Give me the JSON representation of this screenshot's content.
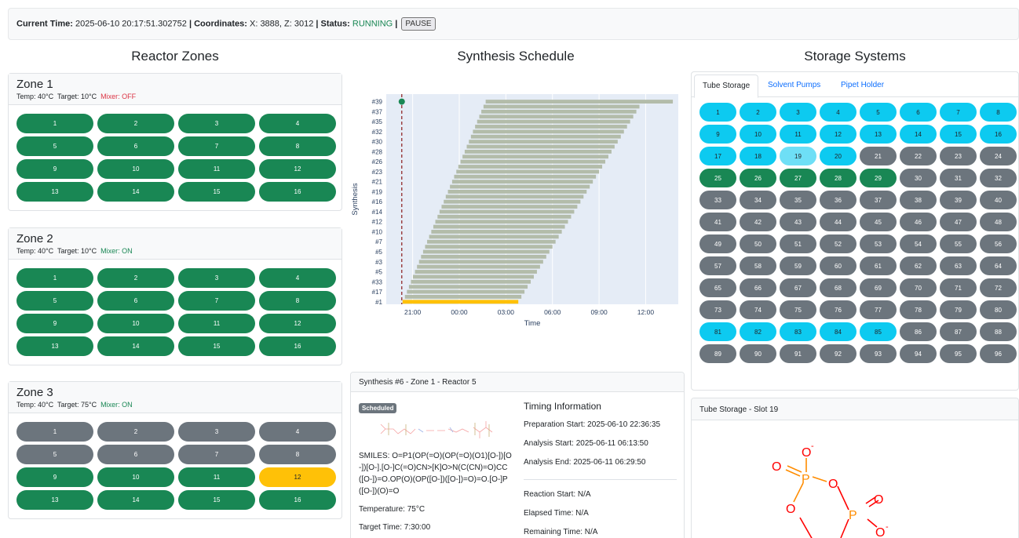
{
  "status": {
    "time_label": "Current Time:",
    "time_value": " 2025-06-10 20:17:51.302752 ",
    "sep1": "|",
    "coords_label": " Coordinates:",
    "coords_value": " X: 3888, Z: 3012 ",
    "sep2": "|",
    "status_label": " Status:",
    "status_value": " RUNNING ",
    "sep3": "| ",
    "pause_label": "PAUSE"
  },
  "titles": {
    "reactor": "Reactor Zones",
    "schedule": "Synthesis Schedule",
    "storage": "Storage Systems"
  },
  "colors": {
    "green": "#198754",
    "grey": "#6c757d",
    "yellow": "#ffc107",
    "cyan": "#0dcaf0",
    "light_cyan": "#6edff6",
    "red": "#dc3545",
    "bar": "#b3bcaa",
    "chart_bg": "#e5ecf6"
  },
  "zones": [
    {
      "name": "Zone 1",
      "temp": "Temp: 40°C",
      "target": "Target: 10°C",
      "mixer": "Mixer: OFF",
      "mixer_on": false,
      "reactors": [
        {
          "label": "1",
          "state": "green"
        },
        {
          "label": "2",
          "state": "green"
        },
        {
          "label": "3",
          "state": "green"
        },
        {
          "label": "4",
          "state": "green"
        },
        {
          "label": "5",
          "state": "green"
        },
        {
          "label": "6",
          "state": "green"
        },
        {
          "label": "7",
          "state": "green"
        },
        {
          "label": "8",
          "state": "green"
        },
        {
          "label": "9",
          "state": "green"
        },
        {
          "label": "10",
          "state": "green"
        },
        {
          "label": "11",
          "state": "green"
        },
        {
          "label": "12",
          "state": "green"
        },
        {
          "label": "13",
          "state": "green"
        },
        {
          "label": "14",
          "state": "green"
        },
        {
          "label": "15",
          "state": "green"
        },
        {
          "label": "16",
          "state": "green"
        }
      ]
    },
    {
      "name": "Zone 2",
      "temp": "Temp: 40°C",
      "target": "Target: 10°C",
      "mixer": "Mixer: ON",
      "mixer_on": true,
      "reactors": [
        {
          "label": "1",
          "state": "green"
        },
        {
          "label": "2",
          "state": "green"
        },
        {
          "label": "3",
          "state": "green"
        },
        {
          "label": "4",
          "state": "green"
        },
        {
          "label": "5",
          "state": "green"
        },
        {
          "label": "6",
          "state": "green"
        },
        {
          "label": "7",
          "state": "green"
        },
        {
          "label": "8",
          "state": "green"
        },
        {
          "label": "9",
          "state": "green"
        },
        {
          "label": "10",
          "state": "green"
        },
        {
          "label": "11",
          "state": "green"
        },
        {
          "label": "12",
          "state": "green"
        },
        {
          "label": "13",
          "state": "green"
        },
        {
          "label": "14",
          "state": "green"
        },
        {
          "label": "15",
          "state": "green"
        },
        {
          "label": "16",
          "state": "green"
        }
      ]
    },
    {
      "name": "Zone 3",
      "temp": "Temp: 40°C",
      "target": "Target: 75°C",
      "mixer": "Mixer: ON",
      "mixer_on": true,
      "reactors": [
        {
          "label": "1",
          "state": "grey"
        },
        {
          "label": "2",
          "state": "grey"
        },
        {
          "label": "3",
          "state": "grey"
        },
        {
          "label": "4",
          "state": "grey"
        },
        {
          "label": "5",
          "state": "grey"
        },
        {
          "label": "6",
          "state": "grey"
        },
        {
          "label": "7",
          "state": "grey"
        },
        {
          "label": "8",
          "state": "grey"
        },
        {
          "label": "9",
          "state": "green"
        },
        {
          "label": "10",
          "state": "green"
        },
        {
          "label": "11",
          "state": "green"
        },
        {
          "label": "12",
          "state": "yellow"
        },
        {
          "label": "13",
          "state": "green"
        },
        {
          "label": "14",
          "state": "green"
        },
        {
          "label": "15",
          "state": "green"
        },
        {
          "label": "16",
          "state": "green"
        }
      ]
    }
  ],
  "chart_data": {
    "type": "bar",
    "orientation": "horizontal-timeline",
    "xlabel": "Time",
    "ylabel": "Synthesis",
    "x_ticks": [
      "21:00",
      "00:00",
      "03:00",
      "06:00",
      "09:00",
      "12:00"
    ],
    "x_tick_hours": [
      21,
      24,
      27,
      30,
      33,
      36
    ],
    "xlim_hours": [
      19.3,
      38.1
    ],
    "y_tick_labels": [
      "#1",
      "#17",
      "#33",
      "#5",
      "#3",
      "#5",
      "#7",
      "#10",
      "#12",
      "#14",
      "#16",
      "#19",
      "#21",
      "#23",
      "#26",
      "#28",
      "#30",
      "#32",
      "#35",
      "#37",
      "#39"
    ],
    "y_tick_rows": [
      0,
      2,
      4,
      6,
      8,
      10,
      12,
      14,
      16,
      18,
      20,
      22,
      24,
      26,
      28,
      30,
      32,
      34,
      36,
      38,
      40
    ],
    "row_count": 42,
    "bars_start_hours": [
      20.35,
      20.5,
      20.63,
      20.76,
      20.89,
      21.02,
      21.15,
      21.28,
      21.41,
      21.54,
      21.67,
      21.8,
      21.93,
      22.06,
      22.2,
      22.33,
      22.46,
      22.6,
      22.73,
      22.86,
      23.0,
      23.13,
      23.27,
      23.4,
      23.54,
      23.67,
      23.81,
      23.94,
      24.08,
      24.21,
      24.35,
      24.48,
      24.62,
      24.75,
      24.88,
      25.02,
      25.15,
      25.29,
      25.42,
      25.56,
      25.7
    ],
    "bars_end_hours": [
      27.8,
      28.0,
      28.2,
      28.4,
      28.6,
      28.8,
      29.0,
      29.2,
      29.4,
      29.6,
      29.8,
      30.0,
      30.2,
      30.4,
      30.6,
      30.8,
      31.0,
      31.2,
      31.4,
      31.6,
      31.8,
      32.0,
      32.2,
      32.4,
      32.6,
      32.8,
      33.0,
      33.2,
      33.4,
      33.6,
      33.8,
      34.0,
      34.2,
      34.4,
      34.6,
      34.8,
      35.0,
      35.2,
      35.4,
      35.6,
      37.75
    ],
    "highlight_row": 0,
    "current_time_hours": 20.3,
    "marker_row": 40,
    "grid": true
  },
  "detail": {
    "title": "Synthesis #6 - Zone 1 - Reactor 5",
    "badge": "Scheduled",
    "smiles": "SMILES: O=P1(OP(=O)(OP(=O)(O1)[O-])[O-])[O-].[O-]C(=O)CN>[K]O>N(C(CN)=O)CC([O-])=O.OP(O)(OP([O-])([O-])=O)=O.[O-]P([O-])(O)=O",
    "temperature": "Temperature: 75°C",
    "target_time": "Target Time: 7:30:00",
    "timing_title": "Timing Information",
    "prep_start": "Preparation Start: 2025-06-10 22:36:35",
    "analysis_start": "Analysis Start: 2025-06-11 06:13:50",
    "analysis_end": "Analysis End: 2025-06-11 06:29:50",
    "reaction_start": "Reaction Start: N/A",
    "elapsed": "Elapsed Time: N/A",
    "remaining": "Remaining Time: N/A"
  },
  "storage": {
    "tabs": [
      "Tube Storage",
      "Solvent Pumps",
      "Pipet Holder"
    ],
    "active_tab": 0,
    "slots": [
      {
        "label": "1",
        "state": "cyan"
      },
      {
        "label": "2",
        "state": "cyan"
      },
      {
        "label": "3",
        "state": "cyan"
      },
      {
        "label": "4",
        "state": "cyan"
      },
      {
        "label": "5",
        "state": "cyan"
      },
      {
        "label": "6",
        "state": "cyan"
      },
      {
        "label": "7",
        "state": "cyan"
      },
      {
        "label": "8",
        "state": "cyan"
      },
      {
        "label": "9",
        "state": "cyan"
      },
      {
        "label": "10",
        "state": "cyan"
      },
      {
        "label": "11",
        "state": "cyan"
      },
      {
        "label": "12",
        "state": "cyan"
      },
      {
        "label": "13",
        "state": "cyan"
      },
      {
        "label": "14",
        "state": "cyan"
      },
      {
        "label": "15",
        "state": "cyan"
      },
      {
        "label": "16",
        "state": "cyan"
      },
      {
        "label": "17",
        "state": "cyan"
      },
      {
        "label": "18",
        "state": "cyan"
      },
      {
        "label": "19",
        "state": "lightcyan"
      },
      {
        "label": "20",
        "state": "cyan"
      },
      {
        "label": "21",
        "state": "grey"
      },
      {
        "label": "22",
        "state": "grey"
      },
      {
        "label": "23",
        "state": "grey"
      },
      {
        "label": "24",
        "state": "grey"
      },
      {
        "label": "25",
        "state": "green"
      },
      {
        "label": "26",
        "state": "green"
      },
      {
        "label": "27",
        "state": "green"
      },
      {
        "label": "28",
        "state": "green"
      },
      {
        "label": "29",
        "state": "green"
      },
      {
        "label": "30",
        "state": "grey"
      },
      {
        "label": "31",
        "state": "grey"
      },
      {
        "label": "32",
        "state": "grey"
      },
      {
        "label": "33",
        "state": "grey"
      },
      {
        "label": "34",
        "state": "grey"
      },
      {
        "label": "35",
        "state": "grey"
      },
      {
        "label": "36",
        "state": "grey"
      },
      {
        "label": "37",
        "state": "grey"
      },
      {
        "label": "38",
        "state": "grey"
      },
      {
        "label": "39",
        "state": "grey"
      },
      {
        "label": "40",
        "state": "grey"
      },
      {
        "label": "41",
        "state": "grey"
      },
      {
        "label": "42",
        "state": "grey"
      },
      {
        "label": "43",
        "state": "grey"
      },
      {
        "label": "44",
        "state": "grey"
      },
      {
        "label": "45",
        "state": "grey"
      },
      {
        "label": "46",
        "state": "grey"
      },
      {
        "label": "47",
        "state": "grey"
      },
      {
        "label": "48",
        "state": "grey"
      },
      {
        "label": "49",
        "state": "grey"
      },
      {
        "label": "50",
        "state": "grey"
      },
      {
        "label": "51",
        "state": "grey"
      },
      {
        "label": "52",
        "state": "grey"
      },
      {
        "label": "53",
        "state": "grey"
      },
      {
        "label": "54",
        "state": "grey"
      },
      {
        "label": "55",
        "state": "grey"
      },
      {
        "label": "56",
        "state": "grey"
      },
      {
        "label": "57",
        "state": "grey"
      },
      {
        "label": "58",
        "state": "grey"
      },
      {
        "label": "59",
        "state": "grey"
      },
      {
        "label": "60",
        "state": "grey"
      },
      {
        "label": "61",
        "state": "grey"
      },
      {
        "label": "62",
        "state": "grey"
      },
      {
        "label": "63",
        "state": "grey"
      },
      {
        "label": "64",
        "state": "grey"
      },
      {
        "label": "65",
        "state": "grey"
      },
      {
        "label": "66",
        "state": "grey"
      },
      {
        "label": "67",
        "state": "grey"
      },
      {
        "label": "68",
        "state": "grey"
      },
      {
        "label": "69",
        "state": "grey"
      },
      {
        "label": "70",
        "state": "grey"
      },
      {
        "label": "71",
        "state": "grey"
      },
      {
        "label": "72",
        "state": "grey"
      },
      {
        "label": "73",
        "state": "grey"
      },
      {
        "label": "74",
        "state": "grey"
      },
      {
        "label": "75",
        "state": "grey"
      },
      {
        "label": "76",
        "state": "grey"
      },
      {
        "label": "77",
        "state": "grey"
      },
      {
        "label": "78",
        "state": "grey"
      },
      {
        "label": "79",
        "state": "grey"
      },
      {
        "label": "80",
        "state": "grey"
      },
      {
        "label": "81",
        "state": "cyan"
      },
      {
        "label": "82",
        "state": "cyan"
      },
      {
        "label": "83",
        "state": "cyan"
      },
      {
        "label": "84",
        "state": "cyan"
      },
      {
        "label": "85",
        "state": "cyan"
      },
      {
        "label": "86",
        "state": "grey"
      },
      {
        "label": "87",
        "state": "grey"
      },
      {
        "label": "88",
        "state": "grey"
      },
      {
        "label": "89",
        "state": "grey"
      },
      {
        "label": "90",
        "state": "grey"
      },
      {
        "label": "91",
        "state": "grey"
      },
      {
        "label": "92",
        "state": "grey"
      },
      {
        "label": "93",
        "state": "grey"
      },
      {
        "label": "94",
        "state": "grey"
      },
      {
        "label": "95",
        "state": "grey"
      },
      {
        "label": "96",
        "state": "grey"
      }
    ]
  },
  "slot_panel": {
    "title": "Tube Storage - Slot 19",
    "atoms": {
      "o": "O",
      "p": "P",
      "charge": "-"
    }
  }
}
